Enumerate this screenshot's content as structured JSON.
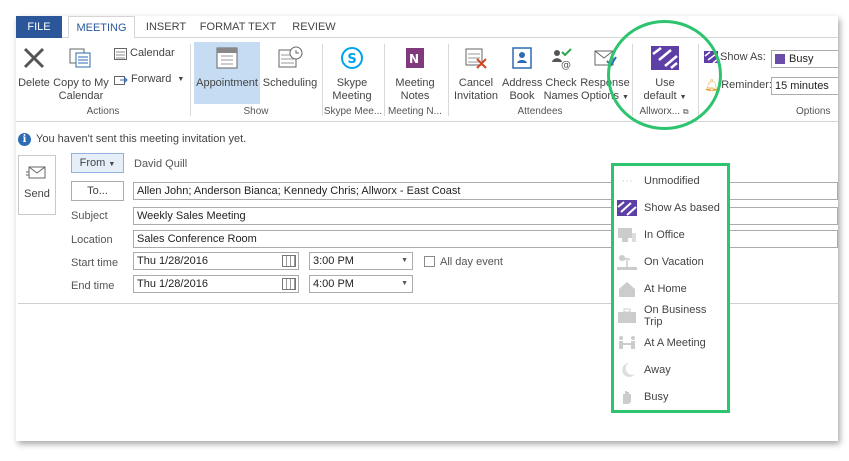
{
  "tabs": [
    {
      "label": "FILE"
    },
    {
      "label": "MEETING"
    },
    {
      "label": "INSERT"
    },
    {
      "label": "FORMAT TEXT"
    },
    {
      "label": "REVIEW"
    }
  ],
  "ribbon": {
    "delete": "Delete",
    "copy_line1": "Copy to My",
    "copy_line2": "Calendar",
    "calendar": "Calendar",
    "forward": "Forward",
    "group_actions": "Actions",
    "appointment": "Appointment",
    "scheduling": "Scheduling",
    "group_show": "Show",
    "skype_line1": "Skype",
    "skype_line2": "Meeting",
    "group_skype": "Skype Mee...",
    "notes_line1": "Meeting",
    "notes_line2": "Notes",
    "group_notes": "Meeting N...",
    "cancel_line1": "Cancel",
    "cancel_line2": "Invitation",
    "address_line1": "Address",
    "address_line2": "Book",
    "check_line1": "Check",
    "check_line2": "Names",
    "response_line1": "Response",
    "response_line2": "Options",
    "group_attendees": "Attendees",
    "use_default_line1": "Use",
    "use_default_line2": "default",
    "group_allworx": "Allworx...",
    "show_as_label": "Show As:",
    "show_as_value": "Busy",
    "reminder_label": "Reminder:",
    "reminder_value": "15 minutes",
    "group_options": "Options"
  },
  "info": {
    "message": "You haven't sent this meeting invitation yet."
  },
  "form": {
    "send": "Send",
    "from_button": "From",
    "from_value": "David Quill",
    "to_button": "To...",
    "to_value": "Allen John; Anderson Bianca; Kennedy Chris; Allworx - East Coast",
    "subject_label": "Subject",
    "subject_value": "Weekly Sales Meeting",
    "location_label": "Location",
    "location_value": "Sales Conference Room",
    "start_label": "Start time",
    "start_date": "Thu 1/28/2016",
    "start_time": "3:00 PM",
    "all_day": "All day event",
    "end_label": "End time",
    "end_date": "Thu 1/28/2016",
    "end_time": "4:00 PM"
  },
  "popup_items": [
    {
      "label": "Unmodified",
      "icon": "dots-icon"
    },
    {
      "label": "Show As based",
      "icon": "allworx-logo-icon"
    },
    {
      "label": "In Office",
      "icon": "office-icon"
    },
    {
      "label": "On Vacation",
      "icon": "vacation-icon"
    },
    {
      "label": "At Home",
      "icon": "home-icon"
    },
    {
      "label": "On Business Trip",
      "icon": "briefcase-icon"
    },
    {
      "label": "At A Meeting",
      "icon": "meeting-icon"
    },
    {
      "label": "Away",
      "icon": "moon-icon"
    },
    {
      "label": "Busy",
      "icon": "hand-icon"
    }
  ],
  "colors": {
    "accent": "#2b579a",
    "highlight": "#2ec46f",
    "selected": "#c5dcf2"
  }
}
